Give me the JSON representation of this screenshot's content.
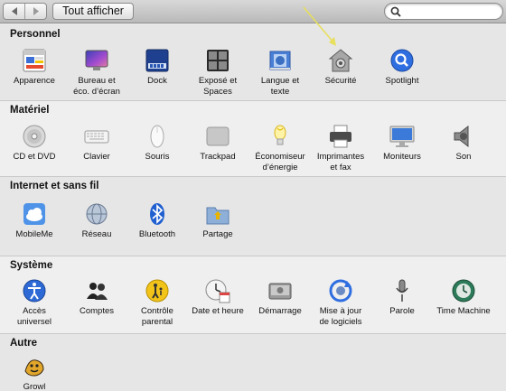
{
  "toolbar": {
    "back_icon": "chevron-left-icon",
    "forward_icon": "chevron-right-icon",
    "show_all_label": "Tout afficher",
    "search_placeholder": "",
    "search_icon": "magnifier-icon"
  },
  "annotation": {
    "arrow_color": "#e8df5a",
    "points_to": "Sécurité"
  },
  "sections": [
    {
      "title": "Personnel",
      "items": [
        {
          "label1": "Apparence",
          "label2": "",
          "icon": "appearance-icon"
        },
        {
          "label1": "Bureau et",
          "label2": "éco. d’écran",
          "icon": "desktop-screensaver-icon"
        },
        {
          "label1": "Dock",
          "label2": "",
          "icon": "dock-icon"
        },
        {
          "label1": "Exposé et",
          "label2": "Spaces",
          "icon": "expose-spaces-icon"
        },
        {
          "label1": "Langue et",
          "label2": "texte",
          "icon": "language-text-icon"
        },
        {
          "label1": "Sécurité",
          "label2": "",
          "icon": "security-house-icon"
        },
        {
          "label1": "Spotlight",
          "label2": "",
          "icon": "spotlight-icon"
        }
      ]
    },
    {
      "title": "Matériel",
      "items": [
        {
          "label1": "CD et DVD",
          "label2": "",
          "icon": "cd-dvd-icon"
        },
        {
          "label1": "Clavier",
          "label2": "",
          "icon": "keyboard-icon"
        },
        {
          "label1": "Souris",
          "label2": "",
          "icon": "mouse-icon"
        },
        {
          "label1": "Trackpad",
          "label2": "",
          "icon": "trackpad-icon"
        },
        {
          "label1": "Économiseur",
          "label2": "d’énergie",
          "icon": "energy-saver-bulb-icon"
        },
        {
          "label1": "Imprimantes",
          "label2": "et fax",
          "icon": "printer-icon"
        },
        {
          "label1": "Moniteurs",
          "label2": "",
          "icon": "monitor-icon"
        },
        {
          "label1": "Son",
          "label2": "",
          "icon": "speaker-icon"
        }
      ]
    },
    {
      "title": "Internet et sans fil",
      "items": [
        {
          "label1": "MobileMe",
          "label2": "",
          "icon": "mobileme-cloud-icon"
        },
        {
          "label1": "Réseau",
          "label2": "",
          "icon": "network-globe-icon"
        },
        {
          "label1": "Bluetooth",
          "label2": "",
          "icon": "bluetooth-icon"
        },
        {
          "label1": "Partage",
          "label2": "",
          "icon": "sharing-folder-icon"
        }
      ]
    },
    {
      "title": "Système",
      "items": [
        {
          "label1": "Accès",
          "label2": "universel",
          "icon": "accessibility-icon"
        },
        {
          "label1": "Comptes",
          "label2": "",
          "icon": "accounts-icon"
        },
        {
          "label1": "Contrôle",
          "label2": "parental",
          "icon": "parental-controls-icon"
        },
        {
          "label1": "Date et heure",
          "label2": "",
          "icon": "date-time-clock-icon"
        },
        {
          "label1": "Démarrage",
          "label2": "",
          "icon": "startup-disk-icon"
        },
        {
          "label1": "Mise à jour",
          "label2": "de logiciels",
          "icon": "software-update-icon"
        },
        {
          "label1": "Parole",
          "label2": "",
          "icon": "speech-microphone-icon"
        },
        {
          "label1": "Time Machine",
          "label2": "",
          "icon": "time-machine-icon"
        }
      ]
    },
    {
      "title": "Autre",
      "items": [
        {
          "label1": "Growl",
          "label2": "",
          "icon": "growl-icon"
        }
      ]
    }
  ]
}
